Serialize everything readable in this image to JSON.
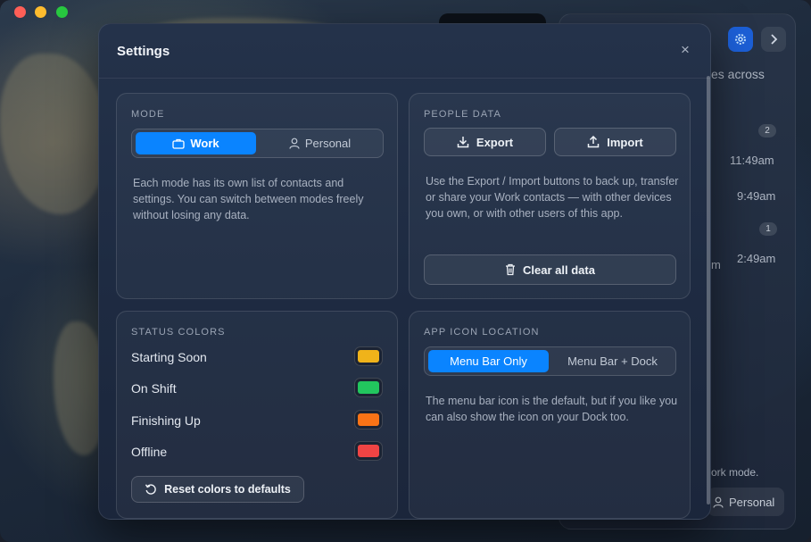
{
  "modal": {
    "title": "Settings",
    "close_label": "×"
  },
  "mode": {
    "header": "MODE",
    "options": [
      {
        "label": "Work",
        "active": true,
        "icon": "briefcase-icon"
      },
      {
        "label": "Personal",
        "active": false,
        "icon": "person-icon"
      }
    ],
    "description": "Each mode has its own list of contacts and settings. You can switch between modes freely without losing any data."
  },
  "people_data": {
    "header": "PEOPLE DATA",
    "export_label": "Export",
    "import_label": "Import",
    "description": "Use the Export / Import buttons to back up, transfer or share your Work contacts — with other devices you own, or with other users of this app.",
    "clear_label": "Clear all data"
  },
  "status_colors": {
    "header": "STATUS COLORS",
    "items": [
      {
        "label": "Starting Soon",
        "color": "#f0b31a"
      },
      {
        "label": "On Shift",
        "color": "#22c55e"
      },
      {
        "label": "Finishing Up",
        "color": "#f97316"
      },
      {
        "label": "Offline",
        "color": "#ef4444"
      }
    ],
    "reset_label": "Reset colors to defaults"
  },
  "app_icon": {
    "header": "APP ICON LOCATION",
    "options": [
      {
        "label": "Menu Bar Only",
        "active": true
      },
      {
        "label": "Menu Bar + Dock",
        "active": false
      }
    ],
    "description": "The menu bar icon is the default, but if you like you can also show the icon on your Dock too."
  },
  "background": {
    "side_panel": {
      "header_text": "es across",
      "badge_1": "2",
      "time_1": "11:49am",
      "time_2": "9:49am",
      "badge_2": "1",
      "time_3": "2:49am",
      "time_3_prefix": "m",
      "footer_text": "ork mode.",
      "personal_label": "Personal"
    }
  }
}
